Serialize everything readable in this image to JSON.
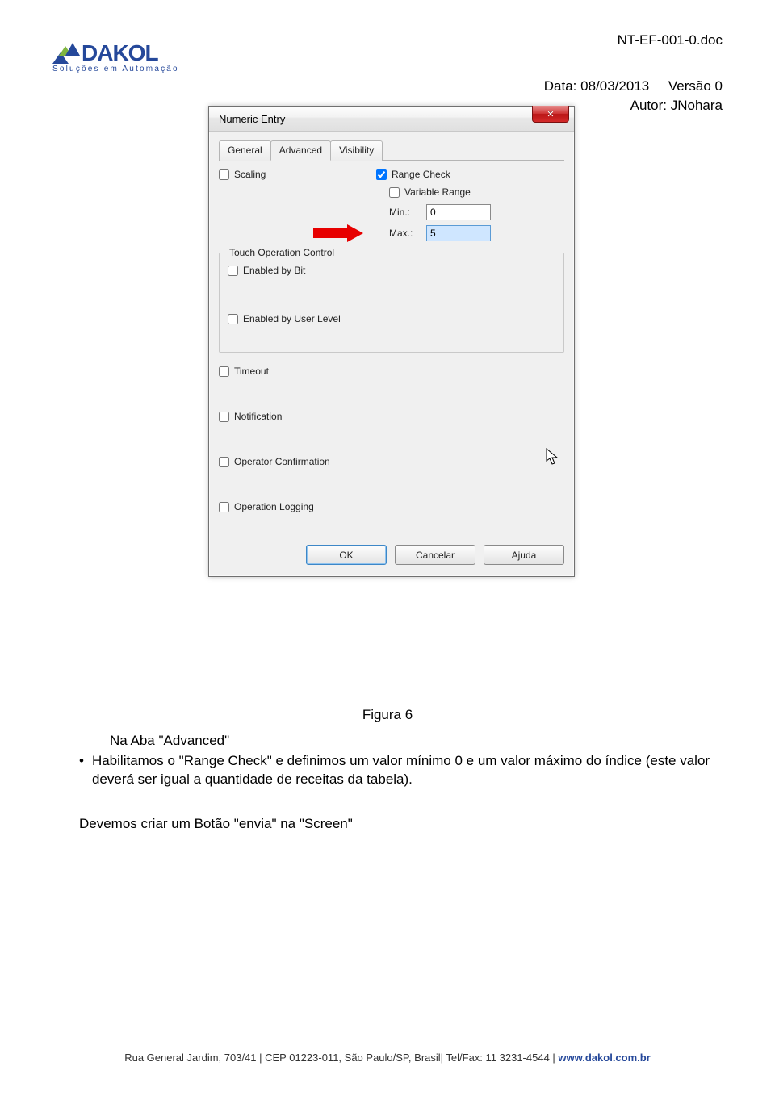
{
  "doc": {
    "filename": "NT-EF-001-0.doc",
    "date_label": "Data:",
    "date": "08/03/2013",
    "version_label": "Versão",
    "version": "0",
    "author_label": "Autor:",
    "author": "JNohara"
  },
  "logo": {
    "name": "DAKOL",
    "subtitle": "Soluções em Automação"
  },
  "dialog": {
    "title": "Numeric Entry",
    "close_glyph": "✕",
    "tabs": [
      "General",
      "Advanced",
      "Visibility"
    ],
    "active_tab": 1,
    "scaling_label": "Scaling",
    "range_check_label": "Range Check",
    "variable_range_label": "Variable Range",
    "min_label": "Min.:",
    "min_value": "0",
    "max_label": "Max.:",
    "max_value": "5",
    "touch_group_title": "Touch Operation Control",
    "enabled_by_bit_label": "Enabled by Bit",
    "enabled_by_user_level_label": "Enabled by User Level",
    "timeout_label": "Timeout",
    "notification_label": "Notification",
    "operator_confirmation_label": "Operator Confirmation",
    "operation_logging_label": "Operation Logging",
    "ok_label": "OK",
    "cancel_label": "Cancelar",
    "help_label": "Ajuda"
  },
  "caption": "Figura 6",
  "para": {
    "line1": "Na Aba \"Advanced\"",
    "bullet": "•",
    "line2": "Habilitamos o \"Range Check\" e definimos um valor mínimo 0 e um valor máximo do índice (este valor deverá ser igual a quantidade de receitas da tabela)."
  },
  "para2": "Devemos criar um Botão \"envia\"  na \"Screen\"",
  "footer": {
    "addr": "Rua General Jardim, 703/41 | CEP 01223-011, São Paulo/SP, Brasil| Tel/Fax: 11 3231-4544 | ",
    "link": "www.dakol.com.br"
  }
}
